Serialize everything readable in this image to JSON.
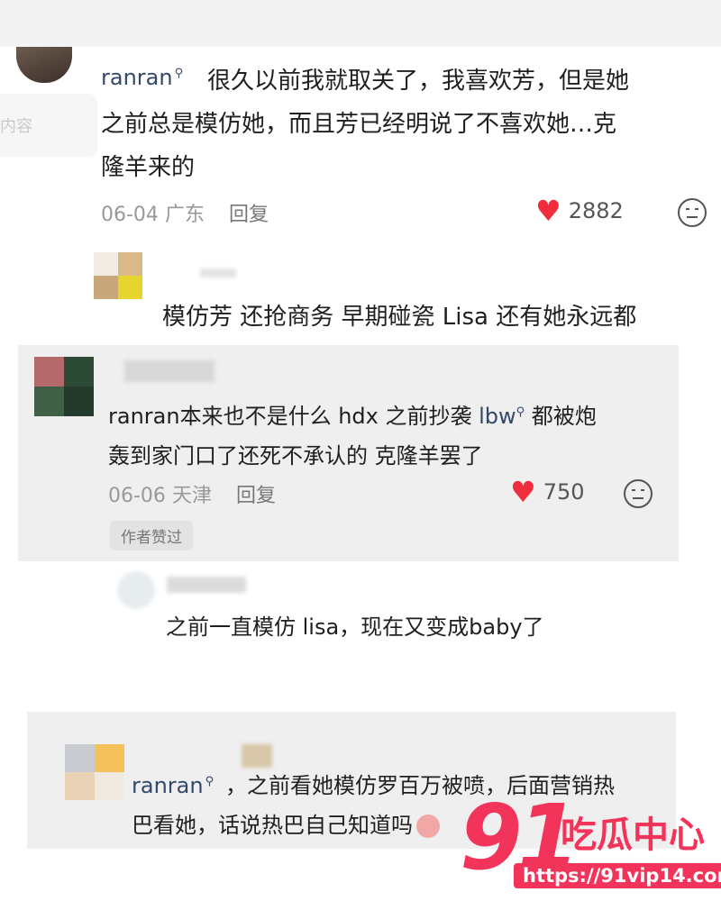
{
  "colors": {
    "accent_like": "#f02d3c",
    "username": "#34486a",
    "watermark": "#f2345a"
  },
  "sidebar_ghost_label": "内容",
  "comments": [
    {
      "username": "ranran",
      "text": "很久以前我就取关了，我喜欢芳，但是她之前总是模仿她，而且芳已经明说了不喜欢她…克隆羊来的",
      "line1": "很久以前我就取关了，我喜欢芳，但是她",
      "line2": "之前总是模仿她，而且芳已经明说了不喜欢她…克",
      "line3": "隆羊来的",
      "date": "06-04",
      "location": "广东",
      "reply_label": "回复",
      "likes": "2882",
      "icons": [
        "heart-icon",
        "dislike-face-icon",
        "search-mark-icon"
      ]
    },
    {
      "text": "模仿芳 还抢商务 早期碰瓷 Lisa 还有她永远都"
    },
    {
      "line1_prefix": "ranran本来也不是什么 hdx 之前抄袭 ",
      "mention": "lbw",
      "line1_suffix": " 都被炮",
      "line2": "轰到家门口了还死不承认的 克隆羊罢了",
      "date": "06-06",
      "location": "天津",
      "reply_label": "回复",
      "likes": "750",
      "badge": "作者赞过"
    },
    {
      "text": "之前一直模仿 lisa，现在又变成baby了"
    },
    {
      "username": "ranran",
      "line1": "，之前看她模仿罗百万被喷，后面营销热",
      "line2": "巴看她，话说热巴自己知道吗"
    }
  ],
  "watermark": {
    "number": "91",
    "brand": "吃瓜中心",
    "url": "https://91vip14.com"
  }
}
